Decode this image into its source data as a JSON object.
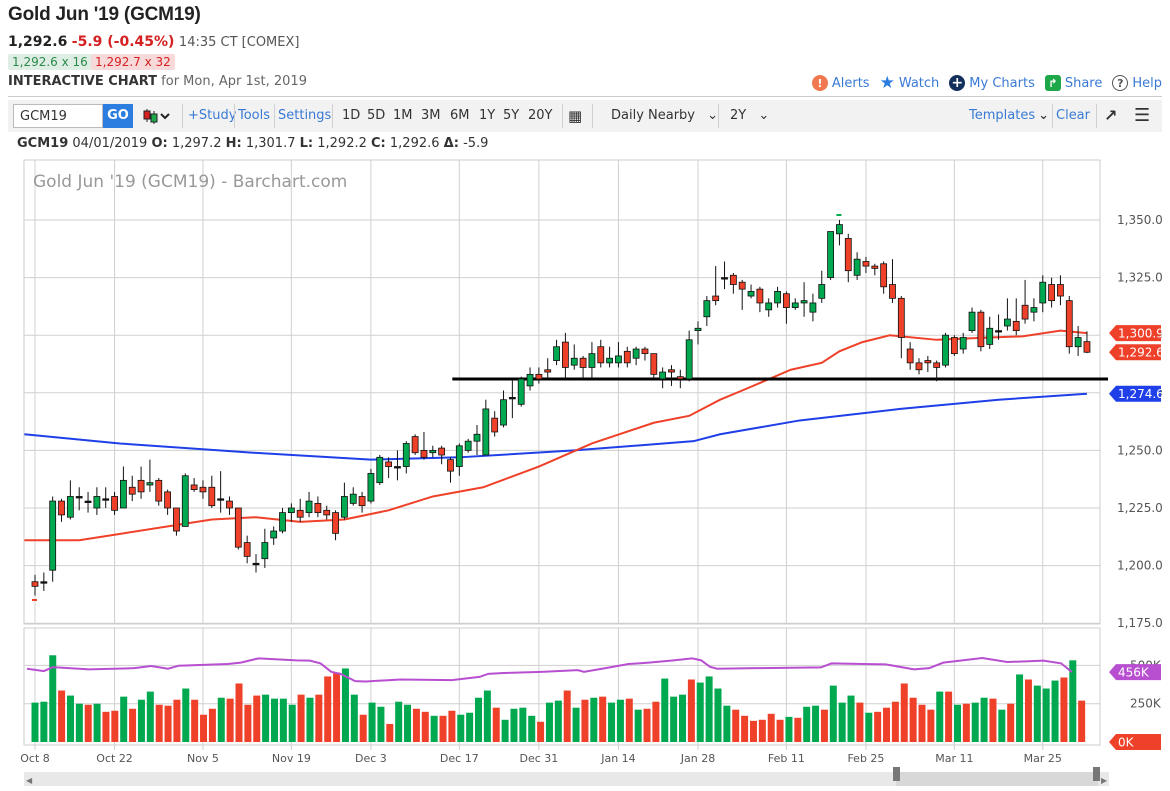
{
  "header": {
    "title": "Gold Jun '19 (GCM19)",
    "last": "1,292.6",
    "change": "-5.9 (-0.45%)",
    "time": "14:35 CT [COMEX]",
    "bid": "1,292.6 x 16",
    "ask": "1,292.7 x 32",
    "interactive_label": "INTERACTIVE CHART",
    "interactive_date": "for Mon, Apr 1st, 2019"
  },
  "links": [
    {
      "label": "Alerts",
      "icon": "alert-icon",
      "color": "#f07850"
    },
    {
      "label": "Watch",
      "icon": "star-icon",
      "color": "#2b7de0"
    },
    {
      "label": "My Charts",
      "icon": "plus-circle-icon",
      "color": "#13315c"
    },
    {
      "label": "Share",
      "icon": "share-icon",
      "color": "#1fa84a"
    },
    {
      "label": "Help",
      "icon": "help-icon",
      "color": "#555555"
    }
  ],
  "toolbar": {
    "symbol": "GCM19",
    "go": "GO",
    "study": "+Study",
    "tools": "Tools",
    "settings": "Settings",
    "periods": [
      "1D",
      "5D",
      "1M",
      "3M",
      "6M",
      "1Y",
      "5Y",
      "20Y"
    ],
    "aggregation": "Daily Nearby",
    "range": "2Y",
    "templates": "Templates",
    "clear": "Clear"
  },
  "ohlc": {
    "symbol": "GCM19",
    "date": "04/01/2019",
    "o_label": "O:",
    "o": "1,297.2",
    "h_label": "H:",
    "h": "1,301.7",
    "l_label": "L:",
    "l": "1,292.2",
    "c_label": "C:",
    "c": "1,292.6",
    "d_label": "Δ:",
    "d": "-5.9"
  },
  "chart_data": {
    "type": "candlestick",
    "watermark": "Gold Jun '19 (GCM19) - Barchart.com",
    "ylim": [
      1175,
      1362
    ],
    "y_ticks": [
      "1,350.0",
      "1,325.0",
      "1,300.0",
      "1,275.0",
      "1,250.0",
      "1,225.0",
      "1,200.0",
      "1,175.0"
    ],
    "y_tick_values": [
      1350,
      1325,
      1300,
      1275,
      1250,
      1225,
      1200,
      1175
    ],
    "x_ticks": [
      {
        "label": "Oct 8",
        "index": 0
      },
      {
        "label": "Oct 22",
        "index": 9
      },
      {
        "label": "Nov 5",
        "index": 19
      },
      {
        "label": "Nov 19",
        "index": 29
      },
      {
        "label": "Dec 3",
        "index": 38
      },
      {
        "label": "Dec 17",
        "index": 48
      },
      {
        "label": "Dec 31",
        "index": 57
      },
      {
        "label": "Jan 14",
        "index": 66
      },
      {
        "label": "Jan 28",
        "index": 75
      },
      {
        "label": "Feb 11",
        "index": 85
      },
      {
        "label": "Feb 25",
        "index": 94
      },
      {
        "label": "Mar 11",
        "index": 104
      },
      {
        "label": "Mar 25",
        "index": 114
      }
    ],
    "colors": {
      "up": "#00a84f",
      "down": "#ef4129",
      "ma50": "#ef4129",
      "ma200": "#1f3fe8",
      "vol_ma": "#b84fd0",
      "support": "#000000"
    },
    "ohlc": [
      [
        1193,
        1196,
        1187,
        1191
      ],
      [
        1193,
        1197,
        1189,
        1193
      ],
      [
        1198,
        1230,
        1193,
        1228
      ],
      [
        1228,
        1229,
        1219,
        1222
      ],
      [
        1221,
        1237,
        1220,
        1230
      ],
      [
        1230,
        1234,
        1224,
        1230
      ],
      [
        1228,
        1232,
        1223,
        1228
      ],
      [
        1225,
        1234,
        1222,
        1230
      ],
      [
        1229,
        1234,
        1225,
        1229
      ],
      [
        1230,
        1232,
        1222,
        1224
      ],
      [
        1225,
        1243,
        1225,
        1237
      ],
      [
        1234,
        1239,
        1228,
        1231
      ],
      [
        1237,
        1243,
        1229,
        1232
      ],
      [
        1235,
        1246,
        1232,
        1236
      ],
      [
        1237,
        1238,
        1226,
        1228
      ],
      [
        1232,
        1233,
        1222,
        1225
      ],
      [
        1225,
        1225,
        1213,
        1215
      ],
      [
        1217,
        1240,
        1217,
        1239
      ],
      [
        1235,
        1238,
        1232,
        1233
      ],
      [
        1234,
        1237,
        1229,
        1232
      ],
      [
        1234,
        1239,
        1225,
        1226
      ],
      [
        1229,
        1241,
        1223,
        1229
      ],
      [
        1228,
        1230,
        1222,
        1225
      ],
      [
        1225,
        1225,
        1207,
        1208
      ],
      [
        1210,
        1213,
        1201,
        1204
      ],
      [
        1201,
        1205,
        1197,
        1201
      ],
      [
        1203,
        1216,
        1199,
        1210
      ],
      [
        1212,
        1217,
        1209,
        1215
      ],
      [
        1215,
        1225,
        1214,
        1223
      ],
      [
        1223,
        1227,
        1219,
        1225
      ],
      [
        1224,
        1229,
        1219,
        1221
      ],
      [
        1223,
        1232,
        1221,
        1228
      ],
      [
        1227,
        1230,
        1221,
        1223
      ],
      [
        1224,
        1226,
        1220,
        1222
      ],
      [
        1223,
        1224,
        1211,
        1214
      ],
      [
        1221,
        1236,
        1220,
        1230
      ],
      [
        1227,
        1234,
        1226,
        1231
      ],
      [
        1230,
        1232,
        1223,
        1226
      ],
      [
        1228,
        1242,
        1227,
        1240
      ],
      [
        1236,
        1248,
        1235,
        1247
      ],
      [
        1245,
        1247,
        1238,
        1243
      ],
      [
        1243,
        1250,
        1237,
        1243
      ],
      [
        1243,
        1254,
        1240,
        1253
      ],
      [
        1256,
        1257,
        1248,
        1249
      ],
      [
        1250,
        1258,
        1246,
        1247
      ],
      [
        1249,
        1252,
        1247,
        1250
      ],
      [
        1251,
        1252,
        1244,
        1248
      ],
      [
        1246,
        1247,
        1236,
        1241
      ],
      [
        1243,
        1253,
        1239,
        1252
      ],
      [
        1250,
        1255,
        1249,
        1254
      ],
      [
        1254,
        1261,
        1248,
        1257
      ],
      [
        1248,
        1272,
        1248,
        1268
      ],
      [
        1264,
        1267,
        1256,
        1258
      ],
      [
        1261,
        1276,
        1260,
        1272
      ],
      [
        1273,
        1281,
        1264,
        1273
      ],
      [
        1270,
        1282,
        1269,
        1281
      ],
      [
        1278,
        1286,
        1276,
        1283
      ],
      [
        1283,
        1286,
        1279,
        1281
      ],
      [
        1285,
        1290,
        1281,
        1284
      ],
      [
        1289,
        1298,
        1287,
        1295
      ],
      [
        1297,
        1301,
        1281,
        1286
      ],
      [
        1287,
        1296,
        1285,
        1290
      ],
      [
        1290,
        1291,
        1281,
        1286
      ],
      [
        1286,
        1297,
        1281,
        1292
      ],
      [
        1295,
        1298,
        1286,
        1288
      ],
      [
        1288,
        1295,
        1286,
        1290
      ],
      [
        1288,
        1297,
        1286,
        1291
      ],
      [
        1293,
        1295,
        1286,
        1288
      ],
      [
        1290,
        1295,
        1287,
        1294
      ],
      [
        1294,
        1295,
        1289,
        1292
      ],
      [
        1292,
        1292,
        1281,
        1283
      ],
      [
        1281,
        1286,
        1277,
        1284
      ],
      [
        1285,
        1287,
        1278,
        1284
      ],
      [
        1282,
        1285,
        1277,
        1281
      ],
      [
        1281,
        1302,
        1280,
        1298
      ],
      [
        1302,
        1306,
        1296,
        1303
      ],
      [
        1308,
        1317,
        1304,
        1315
      ],
      [
        1317,
        1330,
        1313,
        1315
      ],
      [
        1325,
        1332,
        1320,
        1325
      ],
      [
        1326,
        1327,
        1318,
        1322
      ],
      [
        1323,
        1324,
        1311,
        1320
      ],
      [
        1317,
        1322,
        1316,
        1319
      ],
      [
        1320,
        1321,
        1310,
        1314
      ],
      [
        1311,
        1316,
        1308,
        1314
      ],
      [
        1314,
        1321,
        1312,
        1319
      ],
      [
        1318,
        1319,
        1305,
        1312
      ],
      [
        1312,
        1316,
        1311,
        1314
      ],
      [
        1314,
        1323,
        1308,
        1315
      ],
      [
        1310,
        1318,
        1306,
        1314
      ],
      [
        1316,
        1328,
        1314,
        1322
      ],
      [
        1325,
        1345,
        1324,
        1345
      ],
      [
        1344,
        1350,
        1339,
        1348
      ],
      [
        1342,
        1344,
        1323,
        1328
      ],
      [
        1326,
        1336,
        1324,
        1333
      ],
      [
        1332,
        1334,
        1327,
        1330
      ],
      [
        1330,
        1331,
        1326,
        1329
      ],
      [
        1331,
        1332,
        1318,
        1321
      ],
      [
        1322,
        1333,
        1314,
        1316
      ],
      [
        1316,
        1317,
        1290,
        1299
      ],
      [
        1294,
        1297,
        1285,
        1288
      ],
      [
        1288,
        1290,
        1283,
        1285
      ],
      [
        1289,
        1291,
        1284,
        1288
      ],
      [
        1288,
        1289,
        1280,
        1286
      ],
      [
        1287,
        1301,
        1286,
        1300
      ],
      [
        1299,
        1300,
        1291,
        1292
      ],
      [
        1294,
        1301,
        1292,
        1299
      ],
      [
        1302,
        1312,
        1301,
        1310
      ],
      [
        1310,
        1311,
        1293,
        1295
      ],
      [
        1296,
        1308,
        1294,
        1303
      ],
      [
        1302,
        1309,
        1298,
        1302
      ],
      [
        1304,
        1316,
        1302,
        1307
      ],
      [
        1306,
        1316,
        1300,
        1302
      ],
      [
        1313,
        1324,
        1305,
        1307
      ],
      [
        1310,
        1316,
        1306,
        1312
      ],
      [
        1314,
        1326,
        1310,
        1323
      ],
      [
        1322,
        1325,
        1312,
        1315
      ],
      [
        1322,
        1326,
        1313,
        1317
      ],
      [
        1315,
        1317,
        1292,
        1295
      ],
      [
        1295,
        1304,
        1291,
        1299
      ],
      [
        1297.2,
        1301.7,
        1292.2,
        1292.6
      ]
    ],
    "ma50": [
      [
        -1.2,
        1211
      ],
      [
        5,
        1211
      ],
      [
        10,
        1214
      ],
      [
        20,
        1220
      ],
      [
        25,
        1221
      ],
      [
        30,
        1219
      ],
      [
        35,
        1220
      ],
      [
        40,
        1224
      ],
      [
        45,
        1230
      ],
      [
        50.7,
        1234
      ],
      [
        57,
        1243
      ],
      [
        63,
        1253
      ],
      [
        70,
        1262
      ],
      [
        74,
        1265
      ],
      [
        77.5,
        1272
      ],
      [
        80,
        1276
      ],
      [
        85.5,
        1285
      ],
      [
        89,
        1288
      ],
      [
        91,
        1293
      ],
      [
        93.6,
        1297
      ],
      [
        96.7,
        1300
      ],
      [
        102,
        1298
      ],
      [
        108,
        1299
      ],
      [
        111.7,
        1299.5
      ],
      [
        116,
        1302
      ],
      [
        119,
        1300.9
      ]
    ],
    "ma200": [
      [
        -1.2,
        1257
      ],
      [
        9.6,
        1253
      ],
      [
        24.7,
        1249
      ],
      [
        38,
        1246
      ],
      [
        48,
        1247
      ],
      [
        61,
        1250
      ],
      [
        74.5,
        1254
      ],
      [
        77.5,
        1257
      ],
      [
        86.5,
        1263
      ],
      [
        97.9,
        1268
      ],
      [
        109,
        1272
      ],
      [
        119,
        1274.6
      ]
    ],
    "support_level": 1281,
    "support_from_index": 48,
    "last_labels": [
      {
        "text": "1,300.9",
        "value": 1300.9,
        "color": "#ef4129"
      },
      {
        "text": "1,292.6",
        "value": 1292.6,
        "color": "#ef4129"
      },
      {
        "text": "1,274.6",
        "value": 1274.6,
        "color": "#1f3fe8"
      }
    ],
    "volume": {
      "y_ticks": [
        "500K",
        "250K"
      ],
      "y_tick_values": [
        500,
        250
      ],
      "unit": "K",
      "values": [
        257,
        263,
        566,
        336,
        303,
        250,
        243,
        250,
        197,
        204,
        296,
        217,
        276,
        329,
        243,
        237,
        276,
        349,
        276,
        178,
        217,
        289,
        283,
        382,
        243,
        303,
        309,
        283,
        283,
        243,
        309,
        289,
        309,
        428,
        454,
        480,
        309,
        178,
        257,
        230,
        118,
        263,
        243,
        217,
        197,
        171,
        171,
        204,
        178,
        191,
        289,
        336,
        224,
        145,
        217,
        224,
        171,
        132,
        257,
        270,
        336,
        224,
        276,
        289,
        296,
        257,
        276,
        283,
        211,
        217,
        263,
        414,
        296,
        309,
        408,
        388,
        428,
        349,
        237,
        211,
        171,
        138,
        145,
        184,
        145,
        164,
        158,
        230,
        237,
        211,
        368,
        257,
        303,
        257,
        191,
        197,
        224,
        263,
        382,
        289,
        243,
        211,
        329,
        329,
        243,
        250,
        257,
        289,
        283,
        211,
        250,
        441,
        408,
        368,
        349,
        401,
        421,
        533,
        270
      ],
      "up": "gggrggrgrrgrggrrrgrrrgrrrrggggrgrrrggrggrggrrgrrggggrggggrggrgrgrggrgrrgggrggggrrrrrrgrggrgggrgrrrrrrrgrgrggrgrgrgggrgrg",
      "ma": [
        [
          -0.9,
          478
        ],
        [
          1,
          463
        ],
        [
          2,
          489
        ],
        [
          6.1,
          474
        ],
        [
          11.2,
          482
        ],
        [
          13.1,
          496
        ],
        [
          15,
          478
        ],
        [
          16.2,
          498
        ],
        [
          21.7,
          509
        ],
        [
          23.2,
          518
        ],
        [
          25.2,
          546
        ],
        [
          29.5,
          533
        ],
        [
          31,
          531
        ],
        [
          32.2,
          513
        ],
        [
          33.4,
          458
        ],
        [
          34.5,
          443
        ],
        [
          36.1,
          397
        ],
        [
          37.3,
          395
        ],
        [
          41.2,
          408
        ],
        [
          47,
          404
        ],
        [
          50.1,
          425
        ],
        [
          51.1,
          445
        ],
        [
          52.8,
          450
        ],
        [
          57.1,
          458
        ],
        [
          61.2,
          469
        ],
        [
          61.9,
          458
        ],
        [
          65.2,
          491
        ],
        [
          66.9,
          509
        ],
        [
          69.2,
          518
        ],
        [
          71.7,
          531
        ],
        [
          74.1,
          546
        ],
        [
          75.1,
          533
        ],
        [
          76.1,
          491
        ],
        [
          76.9,
          478
        ],
        [
          81.3,
          482
        ],
        [
          88.6,
          487
        ],
        [
          89.8,
          513
        ],
        [
          93.4,
          509
        ],
        [
          95.9,
          507
        ],
        [
          99.1,
          474
        ],
        [
          100.8,
          482
        ],
        [
          102.4,
          518
        ],
        [
          106.8,
          548
        ],
        [
          109.6,
          522
        ],
        [
          113.7,
          531
        ],
        [
          115.7,
          513
        ],
        [
          116.9,
          456
        ]
      ],
      "last_labels": [
        {
          "text": "456K",
          "value": 456,
          "color": "#b84fd0"
        },
        {
          "text": "0K",
          "value": 0,
          "color": "#ef4129"
        }
      ]
    }
  }
}
